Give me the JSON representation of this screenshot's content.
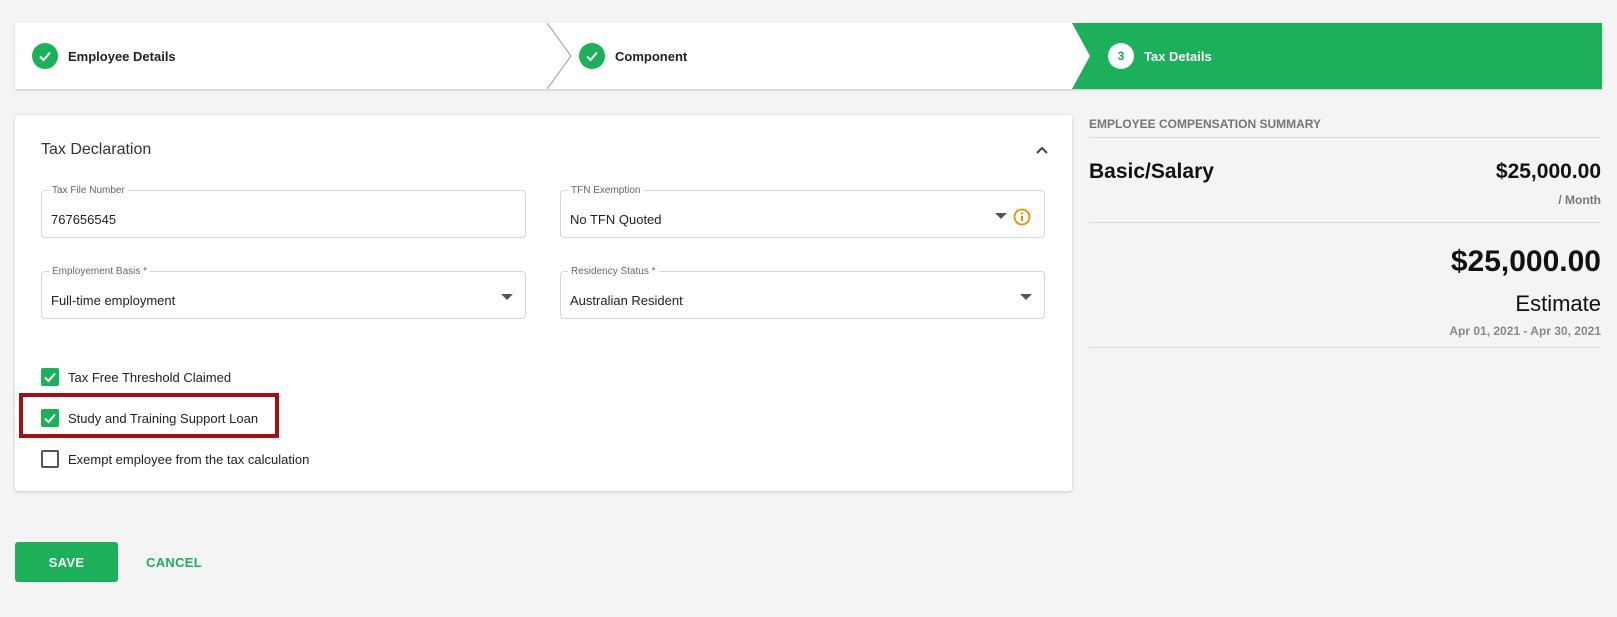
{
  "colors": {
    "accent": "#1db05a",
    "highlight_border": "#a30f14",
    "info": "#f08c00"
  },
  "stepper": {
    "steps": [
      {
        "label": "Employee Details",
        "state": "completed",
        "icon": "check-icon"
      },
      {
        "label": "Component",
        "state": "completed",
        "icon": "check-icon"
      },
      {
        "label": "Tax Details",
        "state": "active",
        "number": "3"
      }
    ]
  },
  "tax_declaration": {
    "title": "Tax Declaration",
    "collapse_icon": "chevron-up-icon",
    "fields": {
      "tax_file_number": {
        "label": "Tax File Number",
        "value": "767656545"
      },
      "tfn_exemption": {
        "label": "TFN Exemption",
        "value": "No TFN Quoted",
        "info_icon": "info-icon"
      },
      "employment_basis": {
        "label": "Employement Basis *",
        "value": "Full-time employment"
      },
      "residency_status": {
        "label": "Residency Status *",
        "value": "Australian Resident"
      }
    },
    "checkboxes": [
      {
        "label": "Tax Free Threshold Claimed",
        "checked": true
      },
      {
        "label": "Study and Training Support Loan",
        "checked": true,
        "highlighted": true
      },
      {
        "label": "Exempt employee from the tax calculation",
        "checked": false
      }
    ]
  },
  "summary": {
    "heading": "EMPLOYEE COMPENSATION SUMMARY",
    "row": {
      "label": "Basic/Salary",
      "amount": "$25,000.00",
      "period": "/ Month"
    },
    "total": {
      "amount": "$25,000.00",
      "label": "Estimate",
      "range": "Apr 01, 2021 - Apr 30, 2021"
    }
  },
  "actions": {
    "save_label": "SAVE",
    "cancel_label": "CANCEL"
  }
}
